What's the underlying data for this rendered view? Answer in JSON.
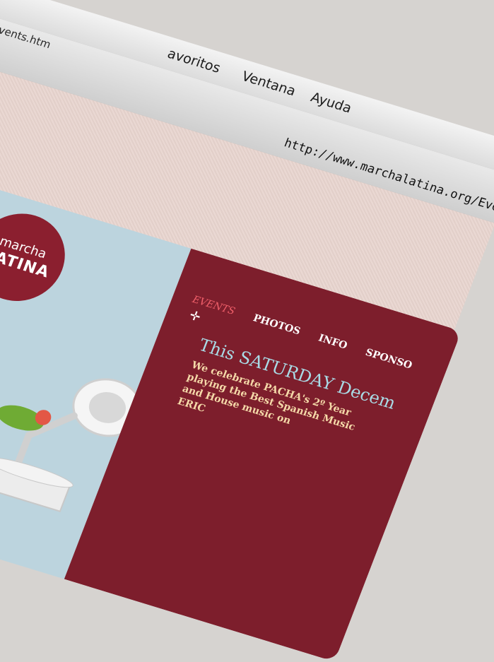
{
  "menubar": {
    "items": [
      "avoritos",
      "Ventana",
      "Ayuda"
    ]
  },
  "tab": {
    "url": "g/Events.htm"
  },
  "address": {
    "url": "http://www.marchalatina.org/Eve"
  },
  "logo": {
    "top": "marcha",
    "bottom": "LATINA"
  },
  "nav": {
    "items": [
      "EVENTS",
      "PHOTOS",
      "INFO",
      "SPONSO"
    ],
    "active": "EVENTS"
  },
  "headline": "This SATURDAY Decem",
  "body_lines": [
    "We celebrate PACHA's 2º Year",
    "playing the Best Spanish Music",
    "and House music on",
    "ERIC"
  ]
}
